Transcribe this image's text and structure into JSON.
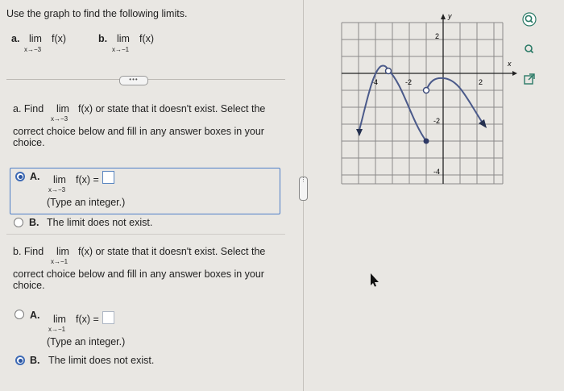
{
  "question": {
    "instruction": "Use the graph to find the following limits.",
    "parts": [
      {
        "letter": "a.",
        "lim": "lim",
        "expr": "f(x)",
        "sub": "x→−3"
      },
      {
        "letter": "b.",
        "lim": "lim",
        "expr": "f(x)",
        "sub": "x→−1"
      }
    ],
    "more_label": "•••"
  },
  "part_a": {
    "prompt_pre": "a. Find",
    "lim": "lim",
    "expr": "f(x) or state that it doesn't exist. Select the",
    "sub": "x→−3",
    "line2": "correct choice below and fill in any answer boxes in your",
    "line3": "choice.",
    "optA_label": "A.",
    "optA_lim": "lim",
    "optA_expr": "f(x) =",
    "optA_sub": "x→−3",
    "optA_note": "(Type an integer.)",
    "optB_label": "B.",
    "optB_text": "The limit does not exist.",
    "selected": "A"
  },
  "part_b": {
    "prompt_pre": "b. Find",
    "lim": "lim",
    "expr": "f(x) or state that it doesn't exist. Select the",
    "sub": "x→−1",
    "line2": "correct choice below and fill in any answer boxes in your",
    "line3": "choice.",
    "optA_label": "A.",
    "optA_lim": "lim",
    "optA_expr": "f(x) =",
    "optA_sub": "x→−1",
    "optA_note": "(Type an integer.)",
    "optB_label": "B.",
    "optB_text": "The limit does not exist.",
    "selected": "B"
  },
  "graph": {
    "x_labels": {
      "neg4": "-4",
      "neg2": "-2",
      "pos2": "2",
      "x": "x"
    },
    "y_labels": {
      "pos2": "2",
      "neg2": "-2",
      "neg4": "-4",
      "y": "y"
    }
  },
  "side_icons": [
    "zoom-in-icon",
    "zoom-out-icon",
    "external-link-icon"
  ]
}
